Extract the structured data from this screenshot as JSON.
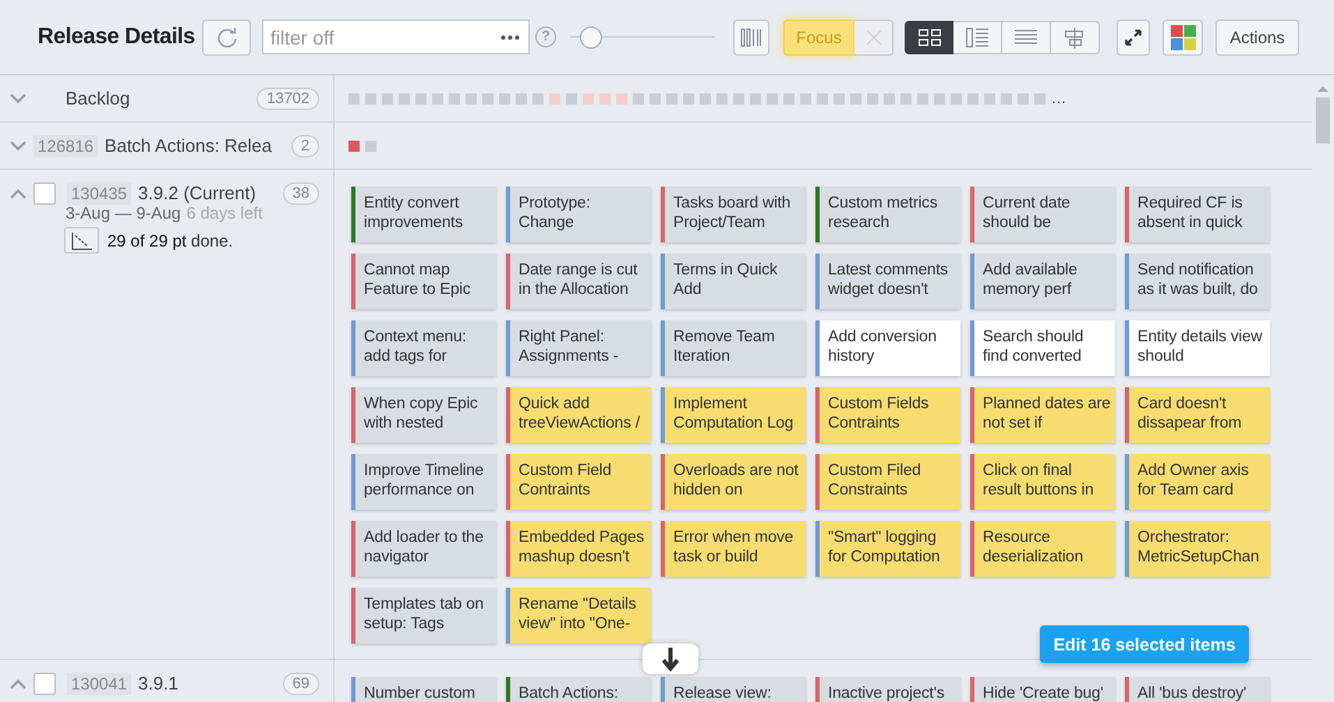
{
  "header": {
    "title": "Release Details",
    "filter": {
      "placeholder": "filter off"
    },
    "help": "?",
    "zoom": {
      "level": 0.07
    },
    "focus": {
      "label": "Focus",
      "active": true,
      "clear_disabled": true
    },
    "views": [
      {
        "kind": "cards",
        "selected": true
      },
      {
        "kind": "details",
        "selected": false
      },
      {
        "kind": "list",
        "selected": false
      },
      {
        "kind": "timeline",
        "selected": false
      }
    ],
    "actions": "Actions"
  },
  "groups": [
    {
      "kind": "backlog",
      "expanded": false,
      "name": "Backlog",
      "count": "13702",
      "more": "…",
      "marks": [
        {
          "color": "#c9ced6"
        },
        {
          "color": "#c9ced6"
        },
        {
          "color": "#c9ced6"
        },
        {
          "color": "#c9ced6"
        },
        {
          "color": "#c9ced6"
        },
        {
          "color": "#c9ced6"
        },
        {
          "color": "#c9ced6"
        },
        {
          "color": "#c9ced6"
        },
        {
          "color": "#c9ced6"
        },
        {
          "color": "#c9ced6"
        },
        {
          "color": "#c9ced6"
        },
        {
          "color": "#c9ced6"
        },
        {
          "color": "#f4cfc9"
        },
        {
          "color": "#c9ced6"
        },
        {
          "color": "#f4cfc9"
        },
        {
          "color": "#f4cfc9"
        },
        {
          "color": "#f4cfc9"
        },
        {
          "color": "#c9ced6"
        },
        {
          "color": "#c9ced6"
        },
        {
          "color": "#c9ced6"
        },
        {
          "color": "#c9ced6"
        },
        {
          "color": "#c9ced6"
        },
        {
          "color": "#c9ced6"
        },
        {
          "color": "#c9ced6"
        },
        {
          "color": "#c9ced6"
        },
        {
          "color": "#c9ced6"
        },
        {
          "color": "#c9ced6"
        },
        {
          "color": "#c9ced6"
        },
        {
          "color": "#c9ced6"
        },
        {
          "color": "#c9ced6"
        },
        {
          "color": "#c9ced6"
        },
        {
          "color": "#c9ced6"
        },
        {
          "color": "#c9ced6"
        },
        {
          "color": "#c9ced6"
        },
        {
          "color": "#c9ced6"
        },
        {
          "color": "#c9ced6"
        },
        {
          "color": "#c9ced6"
        },
        {
          "color": "#c9ced6"
        },
        {
          "color": "#c9ced6"
        },
        {
          "color": "#c9ced6"
        },
        {
          "color": "#c9ced6"
        },
        {
          "color": "#c9ced6"
        }
      ]
    },
    {
      "kind": "feature",
      "expanded": false,
      "id": "126816",
      "name": "Batch Actions: Relea",
      "count": "2",
      "marks": [
        {
          "color": "#dc5a5f"
        },
        {
          "color": "#c9ced6"
        }
      ]
    },
    {
      "kind": "release",
      "expanded": true,
      "checked": false,
      "id": "130435",
      "name": "3.9.2 (Current)",
      "count": "38",
      "dates": "3-Aug — 9-Aug",
      "remaining": "6 days left",
      "progress": "**29 of 29 pt** done.",
      "cards": [
        {
          "text": "Entity convert improvements",
          "color": "#2a7d1e",
          "kind": "default",
          "selected": false
        },
        {
          "text": "Prototype: Change",
          "color": "#6f9bd6",
          "kind": "default",
          "selected": false
        },
        {
          "text": "Tasks board with Project/Team",
          "color": "#d9646a",
          "kind": "default",
          "selected": false
        },
        {
          "text": "Custom metrics research",
          "color": "#2a7d1e",
          "kind": "default",
          "selected": false
        },
        {
          "text": "Current date should be",
          "color": "#d9646a",
          "kind": "default",
          "selected": false
        },
        {
          "text": "Required CF is absent in quick",
          "color": "#d9646a",
          "kind": "default",
          "selected": false
        },
        {
          "text": "Cannot map Feature to Epic",
          "color": "#d9646a",
          "kind": "default",
          "selected": false
        },
        {
          "text": "Date range is cut in the Allocation",
          "color": "#d9646a",
          "kind": "default",
          "selected": false
        },
        {
          "text": "Terms in Quick Add",
          "color": "#6f9bd6",
          "kind": "default",
          "selected": false
        },
        {
          "text": "Latest comments widget doesn't",
          "color": "#6f9bd6",
          "kind": "default",
          "selected": false
        },
        {
          "text": "Add available memory perf",
          "color": "#6f9bd6",
          "kind": "default",
          "selected": false
        },
        {
          "text": "Send notification as it was built, do",
          "color": "#6f9bd6",
          "kind": "default",
          "selected": false
        },
        {
          "text": "Context menu: add tags for",
          "color": "#6f9bd6",
          "kind": "default",
          "selected": false
        },
        {
          "text": "Right Panel: Assignments -",
          "color": "#6f9bd6",
          "kind": "default",
          "selected": false
        },
        {
          "text": "Remove Team Iteration",
          "color": "#6f9bd6",
          "kind": "default",
          "selected": false
        },
        {
          "text": "Add conversion history",
          "color": "#6f9bd6",
          "kind": "blank",
          "selected": false
        },
        {
          "text": "Search should find converted",
          "color": "#6f9bd6",
          "kind": "blank",
          "selected": false
        },
        {
          "text": "Entity details view should",
          "color": "#6f9bd6",
          "kind": "blank",
          "selected": false
        },
        {
          "text": "When copy Epic with nested",
          "color": "#d9646a",
          "kind": "default",
          "selected": false
        },
        {
          "text": "Quick add treeViewActions /",
          "color": "#d9646a",
          "kind": "default",
          "selected": true
        },
        {
          "text": "Implement Computation Log",
          "color": "#6f9bd6",
          "kind": "default",
          "selected": true
        },
        {
          "text": "Custom Fields Contraints",
          "color": "#d9646a",
          "kind": "default",
          "selected": true
        },
        {
          "text": "Planned dates are not set if",
          "color": "#d9646a",
          "kind": "default",
          "selected": true
        },
        {
          "text": "Card doesn't dissapear from",
          "color": "#d9646a",
          "kind": "default",
          "selected": true
        },
        {
          "text": "Improve Timeline performance on",
          "color": "#6f9bd6",
          "kind": "default",
          "selected": false
        },
        {
          "text": "Custom Field Contraints",
          "color": "#d9646a",
          "kind": "default",
          "selected": true
        },
        {
          "text": "Overloads are not hidden on",
          "color": "#d9646a",
          "kind": "default",
          "selected": true
        },
        {
          "text": "Custom Filed Constraints",
          "color": "#d9646a",
          "kind": "default",
          "selected": true
        },
        {
          "text": "Click on final result buttons in",
          "color": "#d9646a",
          "kind": "default",
          "selected": true
        },
        {
          "text": "Add Owner axis for Team card",
          "color": "#6f9bd6",
          "kind": "default",
          "selected": true
        },
        {
          "text": "Add loader to the navigator",
          "color": "#d9646a",
          "kind": "default",
          "selected": false
        },
        {
          "text": "Embedded Pages mashup doesn't",
          "color": "#d9646a",
          "kind": "default",
          "selected": true
        },
        {
          "text": "Error when move task or build",
          "color": "#d9646a",
          "kind": "default",
          "selected": true
        },
        {
          "text": "\"Smart\" logging for Computation",
          "color": "#6f9bd6",
          "kind": "default",
          "selected": true
        },
        {
          "text": "Resource deserialization",
          "color": "#d9646a",
          "kind": "default",
          "selected": true
        },
        {
          "text": "Orchestrator: MetricSetupChan",
          "color": "#6f9bd6",
          "kind": "default",
          "selected": true
        },
        {
          "text": "Templates tab on setup: Tags",
          "color": "#d9646a",
          "kind": "default",
          "selected": false
        },
        {
          "text": "Rename \"Details view\" into \"One-",
          "color": "#6f9bd6",
          "kind": "default",
          "selected": true
        }
      ]
    },
    {
      "kind": "release",
      "expanded": true,
      "checked": false,
      "id": "130041",
      "name": "3.9.1",
      "count": "69",
      "cards": [
        {
          "text": "Number custom",
          "color": "#6f9bd6",
          "kind": "default",
          "selected": false
        },
        {
          "text": "Batch Actions:",
          "color": "#2a7d1e",
          "kind": "default",
          "selected": false
        },
        {
          "text": "Release view:",
          "color": "#6f9bd6",
          "kind": "default",
          "selected": false
        },
        {
          "text": "Inactive project's",
          "color": "#d9646a",
          "kind": "default",
          "selected": false
        },
        {
          "text": "Hide 'Create bug'",
          "color": "#d9646a",
          "kind": "default",
          "selected": false
        },
        {
          "text": "All 'bus destroy'",
          "color": "#d9646a",
          "kind": "default",
          "selected": false
        }
      ]
    }
  ],
  "edit_button": "Edit 16 selected items"
}
